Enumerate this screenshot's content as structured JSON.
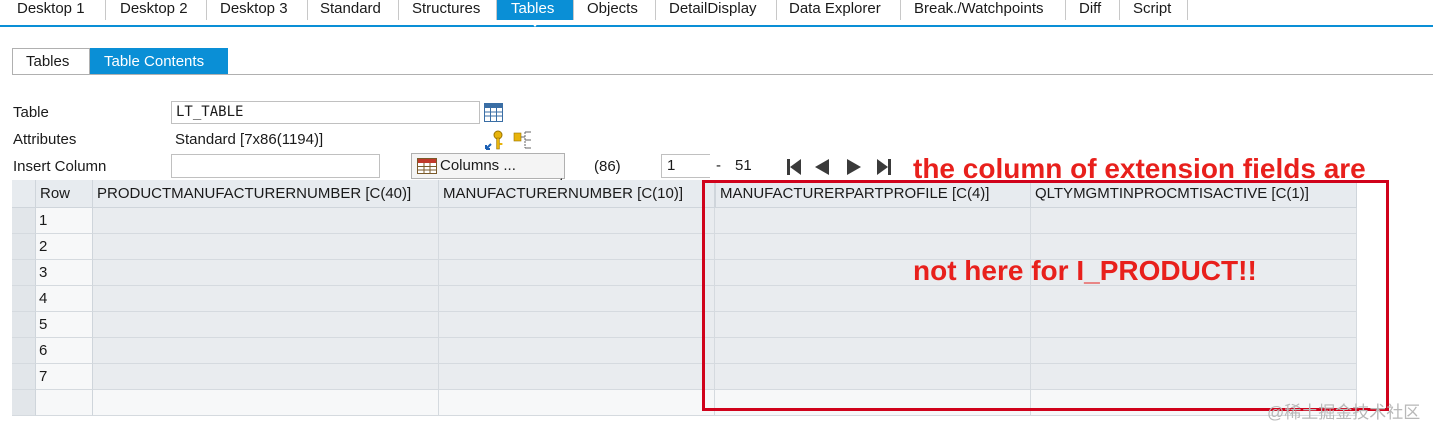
{
  "top_tabs": [
    {
      "label": "Desktop 1"
    },
    {
      "label": "Desktop 2"
    },
    {
      "label": "Desktop 3"
    },
    {
      "label": "Standard"
    },
    {
      "label": "Structures"
    },
    {
      "label": "Tables"
    },
    {
      "label": "Objects"
    },
    {
      "label": "DetailDisplay"
    },
    {
      "label": "Data Explorer"
    },
    {
      "label": "Break./Watchpoints"
    },
    {
      "label": "Diff"
    },
    {
      "label": "Script"
    }
  ],
  "active_top_tab": "Tables",
  "sub_tabs": [
    {
      "label": "Tables"
    },
    {
      "label": "Table Contents"
    }
  ],
  "active_sub_tab": "Table Contents",
  "form": {
    "table_label": "Table",
    "table_value": "LT_TABLE",
    "attributes_label": "Attributes",
    "attributes_value": "Standard [7x86(1194)]",
    "insert_column_label": "Insert Column",
    "insert_column_value": "",
    "columns_button": "Columns ...",
    "total_columns": "(86)",
    "page_from": "1",
    "page_separator": "-",
    "page_to": "51"
  },
  "grid": {
    "row_header": "Row",
    "columns": [
      "PRODUCTMANUFACTURERNUMBER [C(40)]",
      "MANUFACTURERNUMBER [C(10)]",
      "MANUFACTURERPARTPROFILE [C(4)]",
      "QLTYMGMTINPROCMTISACTIVE [C(1)]"
    ],
    "rows": [
      "1",
      "2",
      "3",
      "4",
      "5",
      "6",
      "7"
    ]
  },
  "annotation": {
    "line1": "the column of extension fields are",
    "line2": "not here for I_PRODUCT!!"
  },
  "watermark": "@稀土掘金技术社区",
  "colors": {
    "accent": "#0a8fd6",
    "annotation_red": "#e8201c",
    "grid_cell": "#e9ecef"
  }
}
